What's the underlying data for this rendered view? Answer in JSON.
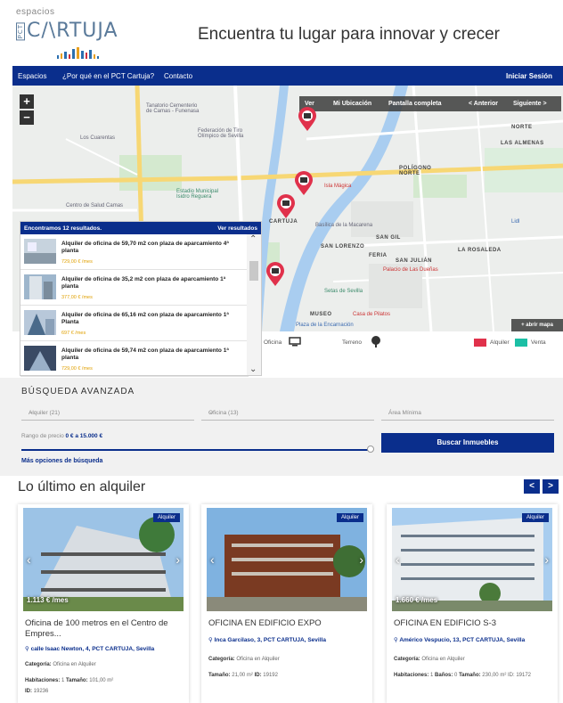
{
  "header": {
    "logo_top": "espacios",
    "logo_pct": "PCT",
    "logo_main": "C/\\RTUJA",
    "tagline": "Encuentra tu lugar para innovar y crecer"
  },
  "nav": {
    "items": [
      "Espacios",
      "¿Por qué en el PCT Cartuja?",
      "Contacto"
    ],
    "login": "Iniciar Sesión"
  },
  "map": {
    "zoom_in": "+",
    "zoom_out": "−",
    "toolbar": [
      "Ver",
      "Mi Ubicación",
      "Pantalla completa",
      "< Anterior",
      "Siguiente >"
    ],
    "labels": {
      "tanatorio": "Tanatorio Cementerio\nde Camas - Funenasa",
      "cuarentas": "Los Cuarentas",
      "federacion": "Federación de Tiro\nOlímpico de Sevilla",
      "norte": "NORTE",
      "alemanas": "LAS ALMENAS",
      "poligono": "POLÍGONO\nNORTE",
      "estadio": "Estadio Municipal\nIsidro Reguera",
      "salud": "Centro de Salud Camas",
      "sangil": "SAN GIL",
      "sanlorenzo": "SAN LORENZO",
      "feria": "FERIA",
      "sanjulian": "SAN JULIÁN",
      "rosaleda": "LA ROSALEDA",
      "duenas": "Palacio de Las Dueñas",
      "setas": "Setas de Sevilla",
      "museo": "MUSEO",
      "pilatos": "Casa de Pilatos",
      "plaza": "Plaza de la Encarnación",
      "lidl": "Lidl",
      "cartuja": "CARTUJA",
      "macarena": "Basílica de la Macarena",
      "ilea": "Isla Mágica"
    },
    "abrir": "+ abrir mapa"
  },
  "results": {
    "header_left": "Encontramos 12 resultados.",
    "header_right": "Ver resultados",
    "items": [
      {
        "title": "Alquiler de oficina de 59,70 m2 con plaza de aparcamiento 4ª planta",
        "price": "729,00 € /mes"
      },
      {
        "title": "Alquiler de oficina de 35,2 m2 con plaza de aparcamiento 1ª planta",
        "price": "377,00 € /mes"
      },
      {
        "title": "Alquiler de oficina de 65,16 m2 con plaza de aparcamiento 1ª Planta",
        "price": "697 € /mes"
      },
      {
        "title": "Alquiler de oficina de 59,74 m2 con plaza de aparcamiento 1ª planta",
        "price": "729,00 € /mes"
      }
    ]
  },
  "legend": {
    "oficina": "Oficina",
    "terreno": "Terreno",
    "alquiler": "Alquiler",
    "venta": "Venta",
    "colors": {
      "alquiler": "#e0314b",
      "venta": "#1bbfa5"
    }
  },
  "advanced": {
    "title": "BÚSQUEDA AVANZADA",
    "select1": "Alquiler (21)",
    "select2": "Oficina (13)",
    "area_placeholder": "Área Mínima",
    "range_prefix": "Rango de precio ",
    "range_value": "0 € a 15.000 €",
    "search_button": "Buscar Inmuebles",
    "more": "Más opciones de búsqueda"
  },
  "latest": {
    "title": "Lo último en alquiler",
    "prev": "<",
    "next": ">",
    "cards": [
      {
        "badge": "Alquiler",
        "price": "1.113 € /mes",
        "title": "Oficina de 100 metros en el Centro de Empres...",
        "address": "calle Isaac Newton, 4, PCT CARTUJA, Sevilla",
        "cat_label": "Categoría:",
        "cat_value": "Oficina en Alquiler",
        "l3_label": "Habitaciones:",
        "l3_value": "1",
        "l3b_label": "Tamaño:",
        "l3b_value": "101,00 m²",
        "l4_label": "ID:",
        "l4_value": "19236"
      },
      {
        "badge": "Alquiler",
        "price": "",
        "title": "OFICINA EN EDIFICIO EXPO",
        "address": "Inca Garcilaso, 3, PCT CARTUJA, Sevilla",
        "cat_label": "Categoría:",
        "cat_value": "Oficina en Alquiler",
        "l3_label": "Tamaño:",
        "l3_value": "21,00 m²",
        "l3b_label": "ID:",
        "l3b_value": "19192",
        "l4_label": "",
        "l4_value": ""
      },
      {
        "badge": "Alquiler",
        "price": "1.660 € /mes",
        "title": "OFICINA EN EDIFICIO S-3",
        "address": "Américo Vespucio, 13, PCT CARTUJA, Sevilla",
        "cat_label": "Categoría:",
        "cat_value": "Oficina en Alquiler",
        "l3_label": "Habitaciones:",
        "l3_value": "1",
        "l3b_label": "Baños:",
        "l3b_value": "0",
        "l4_label": "Tamaño:",
        "l4_value": "230,00 m²  ID: 19172"
      }
    ]
  }
}
